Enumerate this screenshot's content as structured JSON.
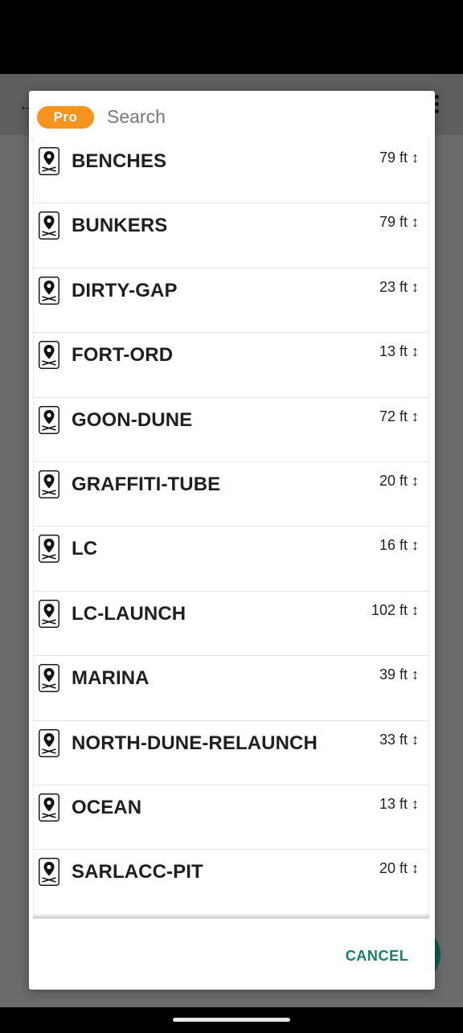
{
  "search": {
    "badge": "Pro",
    "placeholder": "Search"
  },
  "list": {
    "items": [
      {
        "name": "BENCHES",
        "distance": "79 ft ↕"
      },
      {
        "name": "BUNKERS",
        "distance": "79 ft ↕"
      },
      {
        "name": "DIRTY-GAP",
        "distance": "23 ft ↕"
      },
      {
        "name": "FORT-ORD",
        "distance": "13 ft ↕"
      },
      {
        "name": "GOON-DUNE",
        "distance": "72 ft ↕"
      },
      {
        "name": "GRAFFITI-TUBE",
        "distance": "20 ft ↕"
      },
      {
        "name": "LC",
        "distance": "16 ft ↕"
      },
      {
        "name": "LC-LAUNCH",
        "distance": "102 ft ↕"
      },
      {
        "name": "MARINA",
        "distance": "39 ft ↕"
      },
      {
        "name": "NORTH-DUNE-RELAUNCH",
        "distance": "33 ft ↕"
      },
      {
        "name": "OCEAN",
        "distance": "13 ft ↕"
      },
      {
        "name": "SARLACC-PIT",
        "distance": "20 ft ↕"
      }
    ]
  },
  "footer": {
    "cancel_label": "CANCEL"
  },
  "icons": {
    "list_item": "map-pin-takeoff-icon",
    "back": "back-arrow-icon",
    "more": "more-vert-icon"
  },
  "colors": {
    "pro_badge": "#f7941d",
    "cancel_text": "#16806a",
    "fab": "#0d5c4a"
  }
}
